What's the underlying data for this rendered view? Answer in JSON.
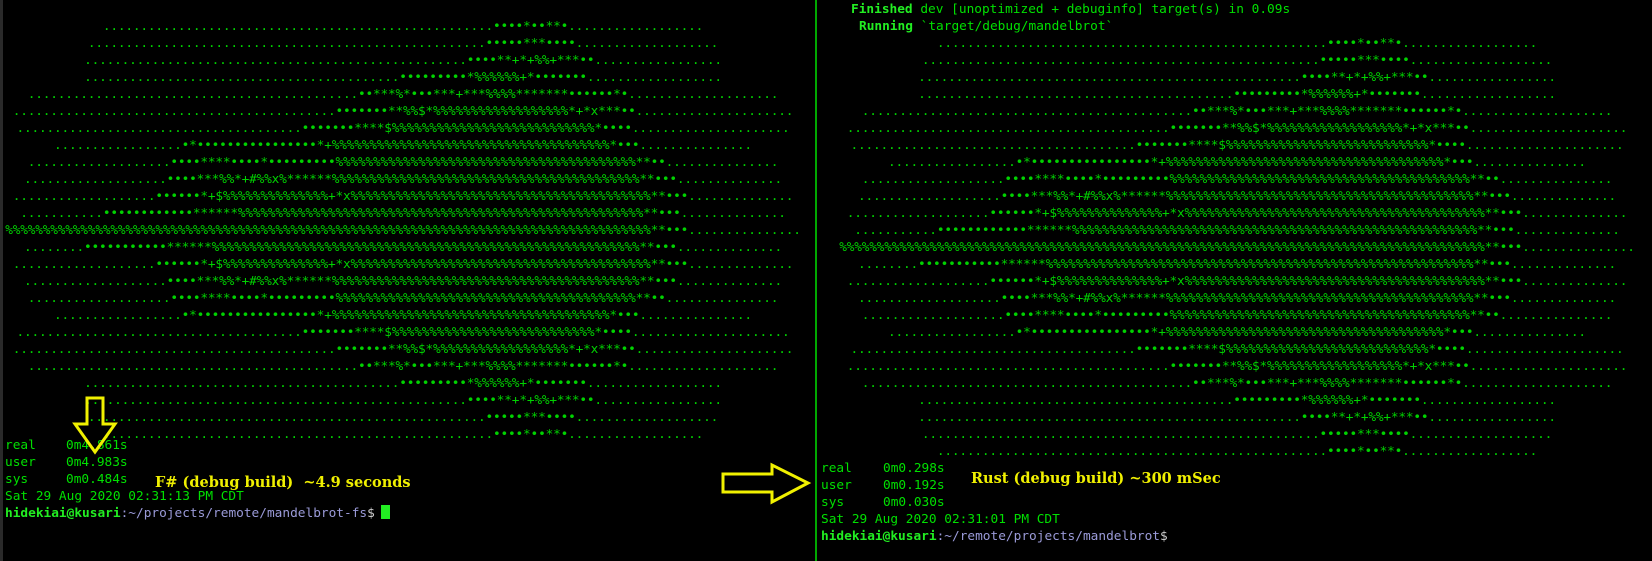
{
  "left": {
    "fractal_rows": [
      "....................................................••••*••**•..................",
      ".....................................................•••••***••••...................",
      "...................................................••••**+*+%%+***••.................",
      "..........................................•••••••••*%%%%%%+*•••••••..................",
      "............................................••***%*•••***+***%%%%*******••••••*•....................",
      "...........................................•••••••**%%$*%%%%%%%%%%%%%%%%%%*+*x***••.....................",
      "......................................•••••••****$%%%%%%%%%%%%%%%%%%%%%%%%%%%*••••.....................",
      ".................•*••••••••••••••••*+%%%%%%%%%%%%%%%%%%%%%%%%%%%%%%%%%%%%%*•••...............",
      "...................••••****••••*•••••••••%%%%%%%%%%%%%%%%%%%%%%%%%%%%%%%%%%%%%%%%**••...............",
      "...................••••***%%*+#%%x%******%%%%%%%%%%%%%%%%%%%%%%%%%%%%%%%%%%%%%%%%%**•••..............",
      "...................••••••*+$%%%%%%%%%%%%%%+*x%%%%%%%%%%%%%%%%%%%%%%%%%%%%%%%%%%%%%%%%**•••..............",
      "...........••••••••••••******%%%%%%%%%%%%%%%%%%%%%%%%%%%%%%%%%%%%%%%%%%%%%%%%%%%%%%**•••..............",
      "%%%%%%%%%%%%%%%%%%%%%%%%%%%%%%%%%%%%%%%%%%%%%%%%%%%%%%%%%%%%%%%%%%%%%%%%%%%%%%%%%%%%%%**•••...............",
      "........•••••••••••******%%%%%%%%%%%%%%%%%%%%%%%%%%%%%%%%%%%%%%%%%%%%%%%%%%%%%%%%%**•••..............",
      "...................••••••*+$%%%%%%%%%%%%%%+*x%%%%%%%%%%%%%%%%%%%%%%%%%%%%%%%%%%%%%%%%**•••..............",
      "...................••••***%%*+#%%x%******%%%%%%%%%%%%%%%%%%%%%%%%%%%%%%%%%%%%%%%%%**•••..............",
      "...................••••****••••*•••••••••%%%%%%%%%%%%%%%%%%%%%%%%%%%%%%%%%%%%%%%%**••...............",
      ".................•*••••••••••••••••*+%%%%%%%%%%%%%%%%%%%%%%%%%%%%%%%%%%%%%*•••...............",
      "......................................•••••••****$%%%%%%%%%%%%%%%%%%%%%%%%%%%*••••.....................",
      "...........................................•••••••**%%$*%%%%%%%%%%%%%%%%%%*+*x***••.....................",
      "............................................••***%*•••***+***%%%%*******••••••*•....................",
      "..........................................•••••••••*%%%%%%+*•••••••..................",
      "...................................................••••**+*+%%+***••.................",
      ".....................................................•••••***••••...................",
      "....................................................••••*••**•.................."
    ],
    "time": {
      "real_label": "real",
      "real_value": "0m4.861s",
      "user_label": "user",
      "user_value": "0m4.983s",
      "sys_label": "sys",
      "sys_value": "0m0.484s"
    },
    "date_line": "Sat 29 Aug 2020 02:31:13 PM CDT",
    "prompt": {
      "user_host": "hidekiai@kusari",
      "path": ":~/projects/remote/mandelbrot-fs",
      "symbol": "$"
    },
    "annotation": "F# (debug build)  ~4.9 seconds"
  },
  "right": {
    "cargo": {
      "finished_keyword": "Finished",
      "finished_text": " dev [unoptimized + debuginfo] target(s) in 0.09s",
      "running_keyword": "Running",
      "running_text": " `target/debug/mandelbrot`"
    },
    "fractal_rows": [
      "....................................................••••*••**•..................",
      ".....................................................•••••***••••...................",
      "...................................................••••**+*+%%+***••.................",
      "..........................................•••••••••*%%%%%%+*•••••••..................",
      "............................................••***%*•••***+***%%%%*******••••••*•....................",
      "...........................................•••••••**%%$*%%%%%%%%%%%%%%%%%%*+*x***••.....................",
      "......................................•••••••****$%%%%%%%%%%%%%%%%%%%%%%%%%%%*••••.....................",
      ".................•*••••••••••••••••*+%%%%%%%%%%%%%%%%%%%%%%%%%%%%%%%%%%%%%*•••...............",
      "...................••••****••••*•••••••••%%%%%%%%%%%%%%%%%%%%%%%%%%%%%%%%%%%%%%%%**••...............",
      "...................••••***%%*+#%%x%******%%%%%%%%%%%%%%%%%%%%%%%%%%%%%%%%%%%%%%%%%**•••..............",
      "...................••••••*+$%%%%%%%%%%%%%%+*x%%%%%%%%%%%%%%%%%%%%%%%%%%%%%%%%%%%%%%%%**•••..............",
      "...........••••••••••••******%%%%%%%%%%%%%%%%%%%%%%%%%%%%%%%%%%%%%%%%%%%%%%%%%%%%%%**•••..............",
      "%%%%%%%%%%%%%%%%%%%%%%%%%%%%%%%%%%%%%%%%%%%%%%%%%%%%%%%%%%%%%%%%%%%%%%%%%%%%%%%%%%%%%%**•••...............",
      "........•••••••••••******%%%%%%%%%%%%%%%%%%%%%%%%%%%%%%%%%%%%%%%%%%%%%%%%%%%%%%%%%**•••..............",
      "...................••••••*+$%%%%%%%%%%%%%%+*x%%%%%%%%%%%%%%%%%%%%%%%%%%%%%%%%%%%%%%%%**•••..............",
      "...................••••***%%*+#%%x%******%%%%%%%%%%%%%%%%%%%%%%%%%%%%%%%%%%%%%%%%%**•••..............",
      "...................••••****••••*•••••••••%%%%%%%%%%%%%%%%%%%%%%%%%%%%%%%%%%%%%%%%**••...............",
      ".................•*••••••••••••••••*+%%%%%%%%%%%%%%%%%%%%%%%%%%%%%%%%%%%%%*•••...............",
      "......................................•••••••****$%%%%%%%%%%%%%%%%%%%%%%%%%%%*••••.....................",
      "...........................................•••••••**%%$*%%%%%%%%%%%%%%%%%%*+*x***••.....................",
      "............................................••***%*•••***+***%%%%*******••••••*•....................",
      "..........................................•••••••••*%%%%%%+*•••••••..................",
      "...................................................••••**+*+%%+***••.................",
      ".....................................................•••••***••••...................",
      "....................................................••••*••**•.................."
    ],
    "time": {
      "real_label": "real",
      "real_value": "0m0.298s",
      "user_label": "user",
      "user_value": "0m0.192s",
      "sys_label": "sys",
      "sys_value": "0m0.030s"
    },
    "date_line": "Sat 29 Aug 2020 02:31:01 PM CDT",
    "prompt": {
      "user_host": "hidekiai@kusari",
      "path": ":~/remote/projects/mandelbrot",
      "symbol": "$"
    },
    "annotation": "Rust (debug build) ~300 mSec"
  },
  "colors": {
    "terminal_green": "#00e000",
    "annotation_yellow": "#f0f000",
    "divider_green": "#00a800",
    "background": "#000000"
  },
  "icons": [
    "arrow-down-icon",
    "arrow-right-icon"
  ]
}
